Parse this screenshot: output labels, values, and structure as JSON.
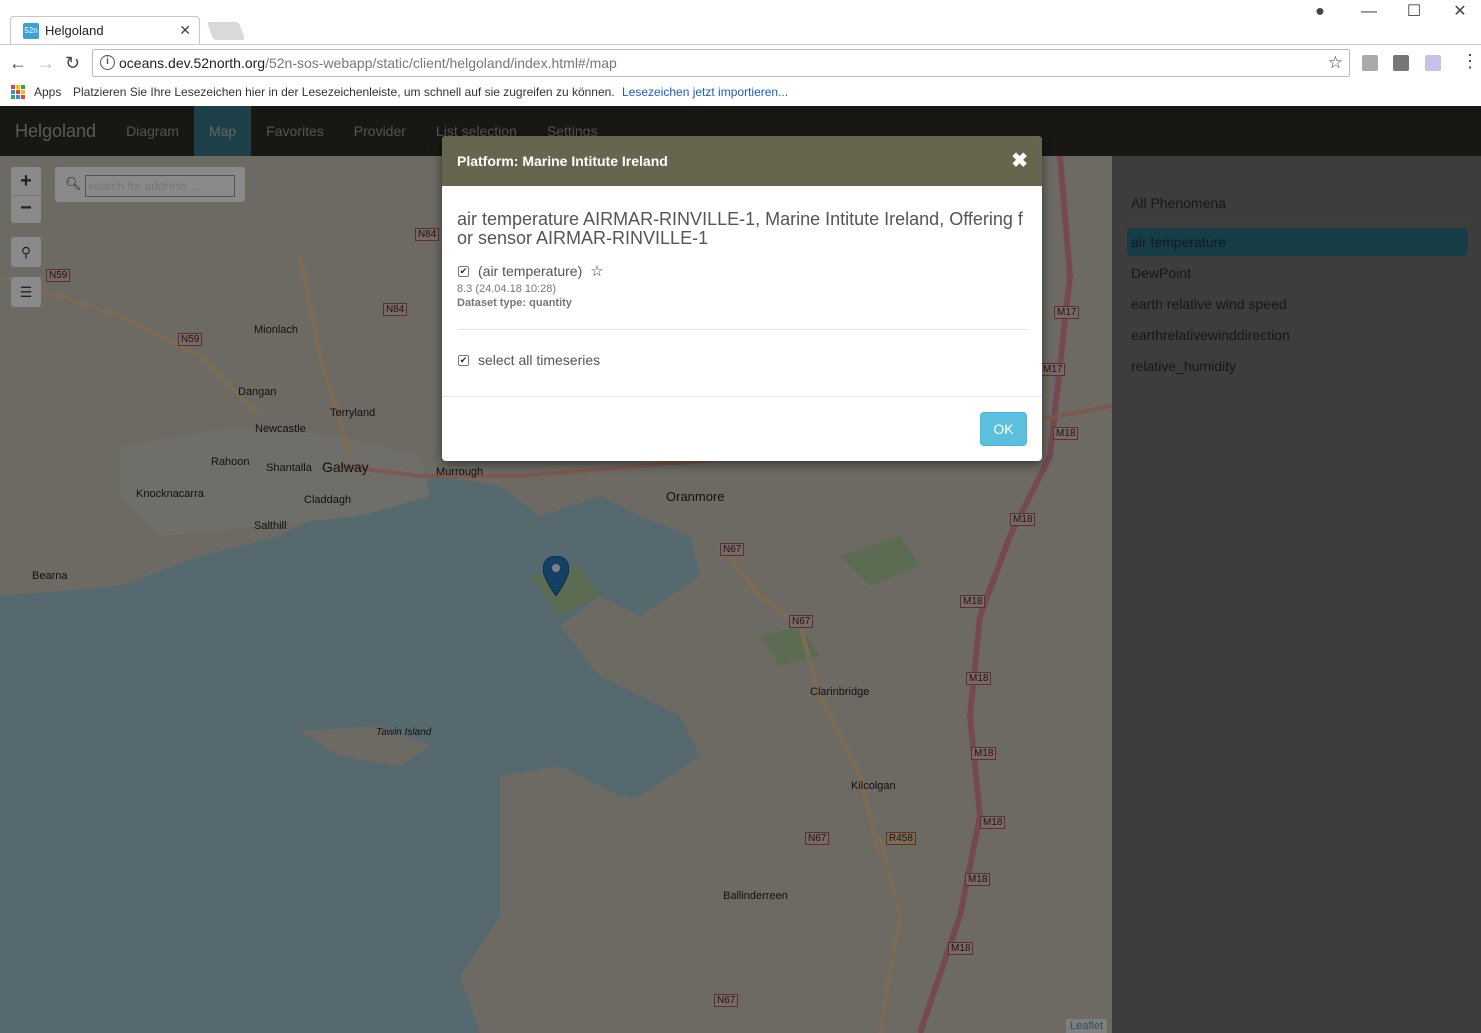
{
  "browser": {
    "tab_title": "Helgoland",
    "favicon_text": "52n",
    "url_host": "oceans.dev.52north.org",
    "url_path": "/52n-sos-webapp/static/client/helgoland/index.html#/map",
    "bookmarks_apps": "Apps",
    "bookmarks_hint": "Platzieren Sie Ihre Lesezeichen hier in der Lesezeichenleiste, um schnell auf sie zugreifen zu können.",
    "bookmarks_import": "Lesezeichen jetzt importieren..."
  },
  "navbar": {
    "brand": "Helgoland",
    "items": [
      {
        "label": "Diagram",
        "active": false
      },
      {
        "label": "Map",
        "active": true
      },
      {
        "label": "Favorites",
        "active": false
      },
      {
        "label": "Provider",
        "active": false
      },
      {
        "label": "List selection",
        "active": false
      },
      {
        "label": "Settings",
        "active": false
      }
    ]
  },
  "map": {
    "search_placeholder": "search for address ...",
    "zoom_in": "+",
    "zoom_out": "−",
    "attribution": "Leaflet",
    "place_labels": [
      "Mionlach",
      "Dangan",
      "Terryland",
      "Newcastle",
      "Rahoon",
      "Shantalla",
      "Galway",
      "Knocknacarra",
      "Claddagh",
      "Salthill",
      "Bearna",
      "Murrough",
      "Oranmore",
      "Clarinbridge",
      "Tawin Island",
      "Kilcolgan",
      "Ballinderreen"
    ],
    "road_labels": [
      "N59",
      "N59",
      "N84",
      "N84",
      "N67",
      "N67",
      "N67",
      "N67",
      "M17",
      "M17",
      "M18",
      "M18",
      "M18",
      "M18",
      "M18",
      "M18",
      "M18",
      "M18",
      "R458"
    ]
  },
  "sidebar": {
    "title": "All Phenomena",
    "items": [
      {
        "label": "air temperature",
        "active": true
      },
      {
        "label": "DewPoint",
        "active": false
      },
      {
        "label": "earth relative wind speed",
        "active": false
      },
      {
        "label": "earthrelativewinddirection",
        "active": false
      },
      {
        "label": "relative_humidity",
        "active": false
      }
    ]
  },
  "modal": {
    "title": "Platform: Marine Intitute Ireland",
    "dataset_title": "air temperature AIRMAR-RINVILLE-1, Marine Intitute Ireland, Offering for sensor AIRMAR-RINVILLE-1",
    "dataset_label": "(air temperature)",
    "last_value": "8.3 (24.04.18 10:28)",
    "dataset_type": "Dataset type: quantity",
    "select_all": "select all timeseries",
    "ok_label": "OK"
  },
  "colors": {
    "navbar_bg": "#2e2f29",
    "nav_active": "#3b7e8e",
    "modal_header": "#66664f",
    "ok_button": "#5bc0de",
    "sidebar_active": "#2c7a8d"
  }
}
